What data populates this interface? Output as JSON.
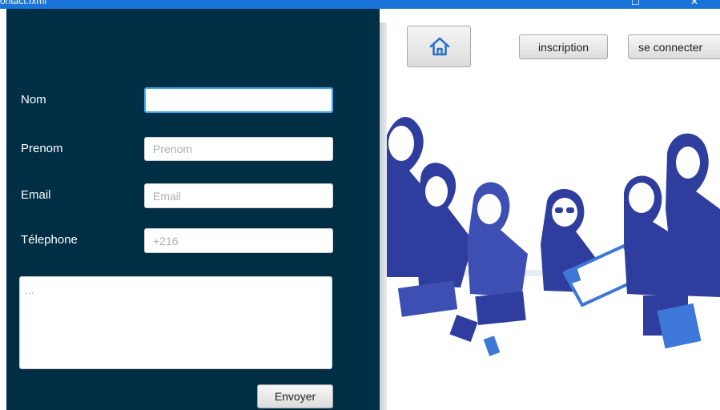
{
  "window": {
    "title": "ontact.fxml",
    "maximize_glyph": "☐",
    "close_glyph": "✕"
  },
  "form": {
    "nom_label": "Nom",
    "nom_value": "",
    "prenom_label": "Prenom",
    "prenom_placeholder": "Prenom",
    "email_label": "Email",
    "email_placeholder": "Email",
    "telephone_label": "Télephone",
    "telephone_placeholder": "+216",
    "message_placeholder": "...",
    "submit_label": "Envoyer"
  },
  "nav": {
    "home_icon": "home-icon",
    "inscription_label": "inscription",
    "connect_label": "se connecter"
  },
  "colors": {
    "titlebar": "#1a73d9",
    "form_background": "#002f45",
    "illustration_primary": "#2f3e9e",
    "illustration_accent": "#3d78d8",
    "focus_border": "#38a6e8"
  }
}
